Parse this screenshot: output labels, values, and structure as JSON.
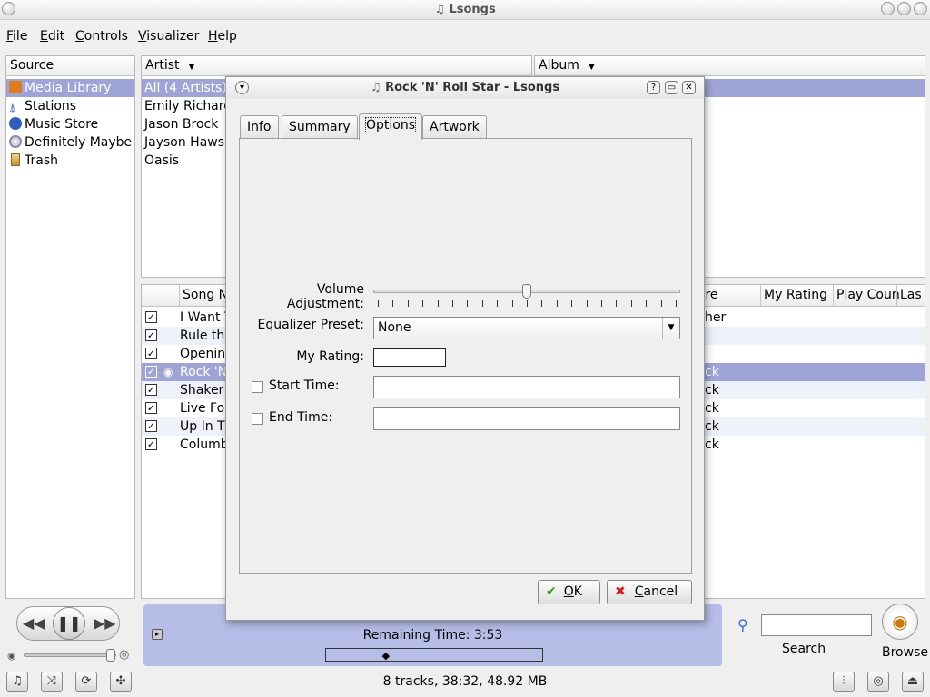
{
  "window": {
    "title": "Lsongs"
  },
  "menu": [
    {
      "label": "File",
      "key": "F",
      "rest": "ile"
    },
    {
      "label": "Edit",
      "key": "E",
      "rest": "dit"
    },
    {
      "label": "Controls",
      "key": "C",
      "rest": "ontrols"
    },
    {
      "label": "Visualizer",
      "key": "V",
      "rest": "isualizer"
    },
    {
      "label": "Help",
      "key": "H",
      "rest": "elp"
    }
  ],
  "source": {
    "header": "Source",
    "items": [
      {
        "label": "Media Library",
        "icon": "media-library-icon",
        "color": "#e07a1e"
      },
      {
        "label": "Stations",
        "icon": "radio-tower-icon",
        "color": "#2f4fa8"
      },
      {
        "label": "Music Store",
        "icon": "music-store-icon",
        "color": "#2f5fb8"
      },
      {
        "label": "Definitely Maybe",
        "icon": "cd-icon",
        "color": "#7a7a9a"
      },
      {
        "label": "Trash",
        "icon": "trash-icon",
        "color": "#c89030"
      }
    ]
  },
  "artist": {
    "header": "Artist",
    "items": [
      "All (4 Artists)",
      "Emily Richards",
      "Jason Brock",
      "Jayson Haws",
      "Oasis"
    ]
  },
  "album": {
    "header": "Album"
  },
  "songs": {
    "columns": {
      "name": "Song N",
      "genre": "enre",
      "rating": "My Rating",
      "playcount": "Play Coun",
      "last": "Las"
    },
    "rows": [
      {
        "name": "I Want T",
        "genre": "her",
        "checked": true
      },
      {
        "name": "Rule the",
        "genre": "",
        "checked": true
      },
      {
        "name": "Openin",
        "genre": "",
        "checked": true
      },
      {
        "name": "Rock 'N",
        "genre": "ck",
        "checked": true,
        "playing": true
      },
      {
        "name": "Shaker",
        "genre": "ck",
        "checked": true
      },
      {
        "name": "Live For",
        "genre": "ck",
        "checked": true
      },
      {
        "name": "Up In Th",
        "genre": "ck",
        "checked": true
      },
      {
        "name": "Columb",
        "genre": "ck",
        "checked": true
      }
    ]
  },
  "dialog": {
    "title": "Rock 'N' Roll Star - Lsongs",
    "tabs": [
      "Info",
      "Summary",
      "Options",
      "Artwork"
    ],
    "active_tab": "Options",
    "volume_label": "Volume Adjustment:",
    "volume_value": 0.5,
    "eq_label": "Equalizer Preset:",
    "eq_value": "None",
    "rating_label": "My Rating:",
    "start_label": "Start Time:",
    "end_label": "End Time:",
    "ok_label": "OK",
    "ok_key": "O",
    "ok_rest": "K",
    "cancel_label": "Cancel",
    "cancel_key": "C",
    "cancel_rest": "ancel"
  },
  "player": {
    "remaining": "Remaining Time: 3:53",
    "progress": 0.28,
    "volume": 0.95
  },
  "search": {
    "label": "Search",
    "placeholder": ""
  },
  "browse": {
    "label": "Browse"
  },
  "status": {
    "summary": "8 tracks, 38:32, 48.92 MB"
  }
}
